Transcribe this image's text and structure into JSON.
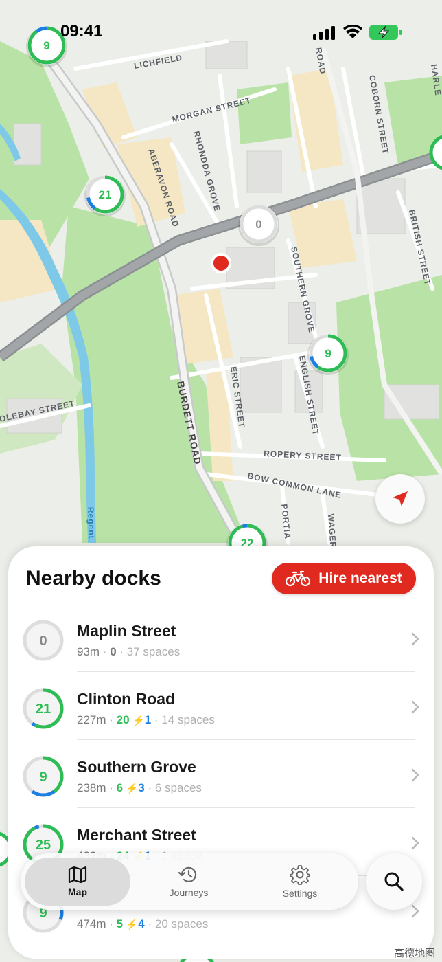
{
  "status_bar": {
    "time": "09:41"
  },
  "map": {
    "streets": [
      {
        "text": "LICHFIELD"
      },
      {
        "text": "MORGAN STREET"
      },
      {
        "text": "ABERAVON ROAD"
      },
      {
        "text": "RHONDDA GROVE"
      },
      {
        "text": "COBORN STREET"
      },
      {
        "text": "ROAD"
      },
      {
        "text": "HARLE"
      },
      {
        "text": "BRITISH STREET"
      },
      {
        "text": "SOUTHERN GROVE"
      },
      {
        "text": "ENGLISH STREET"
      },
      {
        "text": "ERIC STREET"
      },
      {
        "text": "BURDETT ROAD"
      },
      {
        "text": "OLEBAY STREET"
      },
      {
        "text": "ROPERY STREET"
      },
      {
        "text": "BOW COMMON LANE"
      },
      {
        "text": "PORTIA"
      },
      {
        "text": "WAGER"
      },
      {
        "text": "Regent"
      }
    ],
    "markers": [
      {
        "label": "9",
        "bikes": 9,
        "capacity": 10,
        "color": "#2ebd55"
      },
      {
        "label": "21",
        "bikes": 21,
        "capacity": 35,
        "color": "#2ebd55"
      },
      {
        "label": "0",
        "bikes": 0,
        "capacity": 37,
        "color": "#999999"
      },
      {
        "label": "9",
        "bikes": 9,
        "capacity": 15,
        "color": "#2ebd55"
      },
      {
        "label": "22",
        "bikes": 22,
        "capacity": 23,
        "color": "#2ebd55"
      }
    ],
    "copyright": "高德地图"
  },
  "sheet": {
    "title": "Nearby docks",
    "hire_button_label": "Hire nearest",
    "docks": [
      {
        "name": "Maplin Street",
        "distance": "93m",
        "bikes": "0",
        "ebikes": "",
        "spaces": "37 spaces",
        "ring_label": "0",
        "bike_frac": 0,
        "ebike_frac": 0
      },
      {
        "name": "Clinton Road",
        "distance": "227m",
        "bikes": "20",
        "ebikes": "1",
        "spaces": "14 spaces",
        "ring_label": "21",
        "bike_frac": 0.571,
        "ebike_frac": 0.029
      },
      {
        "name": "Southern Grove",
        "distance": "238m",
        "bikes": "6",
        "ebikes": "3",
        "spaces": "6 spaces",
        "ring_label": "9",
        "bike_frac": 0.4,
        "ebike_frac": 0.2
      },
      {
        "name": "Merchant Street",
        "distance": "432m",
        "bikes": "24",
        "ebikes": "1",
        "spaces": "1 space",
        "ring_label": "25",
        "bike_frac": 0.923,
        "ebike_frac": 0.038
      },
      {
        "name": "",
        "distance": "474m",
        "bikes": "5",
        "ebikes": "4",
        "spaces": "20 spaces",
        "ring_label": "9",
        "bike_frac": 0.172,
        "ebike_frac": 0.138
      }
    ]
  },
  "tabbar": {
    "tabs": [
      {
        "label": "Map",
        "icon": "map-icon",
        "active": true
      },
      {
        "label": "Journeys",
        "icon": "history-icon",
        "active": false
      },
      {
        "label": "Settings",
        "icon": "gear-icon",
        "active": false
      }
    ],
    "search_icon": "search-icon"
  },
  "colors": {
    "accent_red": "#e0291f",
    "bike_green": "#2ebd55",
    "ebike_blue": "#1e7fe0",
    "park": "#b9e3a6",
    "water": "#7ec8e8",
    "main_road": "#9a9d9f"
  }
}
